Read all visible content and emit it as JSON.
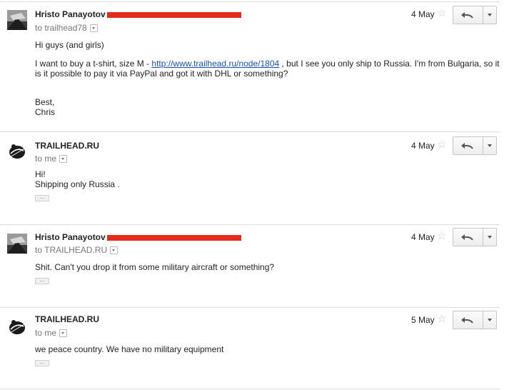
{
  "messages": [
    {
      "sender": "Hristo Panayotov",
      "recipient_label": "to trailhead78",
      "date": "4 May",
      "lines": {
        "greeting": "Hi guys (and girls)",
        "main_pre": "I want to buy a t-shirt, size M - ",
        "main_link": "http://www.trailhead.ru/node/1804",
        "main_post": " , but I see you only ship to Russia. I'm from Bulgaria, so it",
        "main2": "is it possible to pay it via PayPal and got it with DHL or something?",
        "signoff1": "Best,",
        "signoff2": "Chris"
      },
      "avatar": "landscape-photo"
    },
    {
      "sender": "TRAILHEAD.RU",
      "recipient_label": "to me",
      "date": "4 May",
      "lines": {
        "l1": "Hi!",
        "l2": "Shipping only Russia ."
      },
      "ellipsis": "...",
      "avatar": "trailhead-logo"
    },
    {
      "sender": "Hristo Panayotov",
      "recipient_label": "to TRAILHEAD.RU",
      "date": "4 May",
      "lines": {
        "l1": "Shit. Can't you drop it from some military aircraft or something?"
      },
      "ellipsis": "...",
      "avatar": "landscape-photo"
    },
    {
      "sender": "TRAILHEAD.RU",
      "recipient_label": "to me",
      "date": "5 May",
      "lines": {
        "l1": "we peace country. We have no military equipment"
      },
      "ellipsis": "...",
      "avatar": "trailhead-logo"
    }
  ],
  "icons": {
    "star": "star-icon",
    "reply": "reply-icon",
    "more": "chevron-down-icon",
    "redaction_color": "#e32b1e",
    "link_color": "#1a4fb4"
  }
}
